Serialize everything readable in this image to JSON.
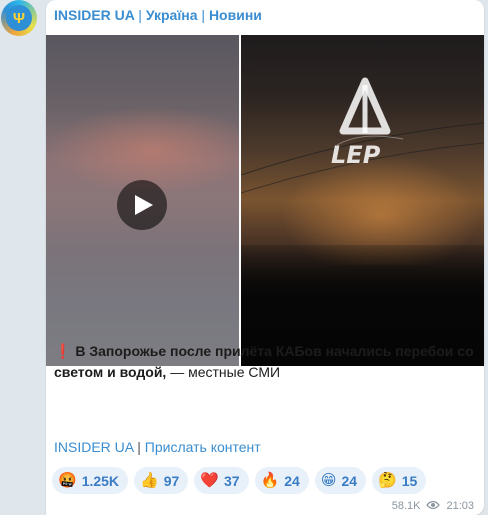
{
  "channel": {
    "avatar_icon": "ukraine-trident-icon",
    "header": {
      "name": "INSIDER UA",
      "sep1": "|",
      "country": "Україна",
      "sep2": "|",
      "section": "Новини"
    }
  },
  "media": {
    "left_video": {
      "play_icon": "play-icon"
    },
    "right_image": {
      "watermark_icon": "lep-logo-icon",
      "watermark_text": "LEP"
    }
  },
  "message": {
    "exclamation": "❗️",
    "headline": "В Запорожье после прилёта КАБов начались перебои со светом и водой,",
    "tail": " — местные СМИ"
  },
  "links": {
    "channel_link": "INSIDER UA",
    "sep": "|",
    "submit_link": "Прислать контент"
  },
  "reactions": [
    {
      "emoji": "🤬",
      "count": "1.25K"
    },
    {
      "emoji": "👍",
      "count": "97"
    },
    {
      "emoji": "❤️",
      "count": "37"
    },
    {
      "emoji": "🔥",
      "count": "24"
    },
    {
      "emoji": "😁",
      "count": "24"
    },
    {
      "emoji": "🤔",
      "count": "15"
    }
  ],
  "meta": {
    "views": "58.1K",
    "views_icon": "eye-icon",
    "time": "21:03"
  }
}
